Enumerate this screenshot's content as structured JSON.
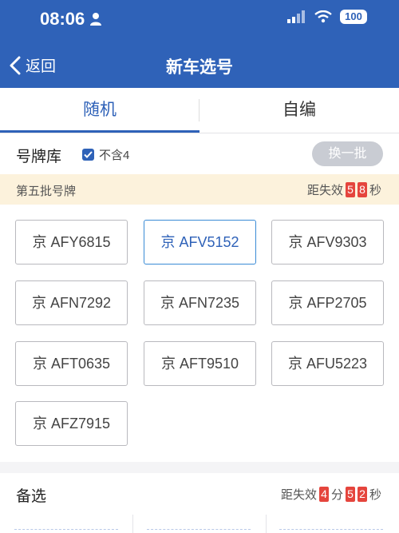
{
  "status_bar": {
    "time": "08:06",
    "battery": "100"
  },
  "nav": {
    "back_label": "返回",
    "title": "新车选号"
  },
  "tabs": [
    {
      "label": "随机",
      "active": true
    },
    {
      "label": "自编",
      "active": false
    }
  ],
  "pool": {
    "label": "号牌库",
    "exclude_four": "不含4",
    "exclude_checked": true,
    "swap_button": "换一批"
  },
  "batch": {
    "label": "第五批号牌",
    "countdown_prefix": "距失效",
    "countdown_digits": [
      "5",
      "8"
    ],
    "countdown_suffix": "秒"
  },
  "plates": [
    "京 AFY6815",
    "京 AFV5152",
    "京 AFV9303",
    "京 AFN7292",
    "京 AFN7235",
    "京 AFP2705",
    "京 AFT0635",
    "京 AFT9510",
    "京 AFU5223",
    "京 AFZ7915"
  ],
  "selected_plate_index": 1,
  "backup": {
    "label": "备选",
    "countdown_prefix": "距失效",
    "minutes_digit": "4",
    "minutes_unit": "分",
    "seconds_digits": [
      "5",
      "2"
    ],
    "seconds_unit": "秒"
  },
  "colors": {
    "brand_blue": "#2f62b8",
    "countdown_red": "#e5453d",
    "banner_bg": "#fcf2dc"
  }
}
